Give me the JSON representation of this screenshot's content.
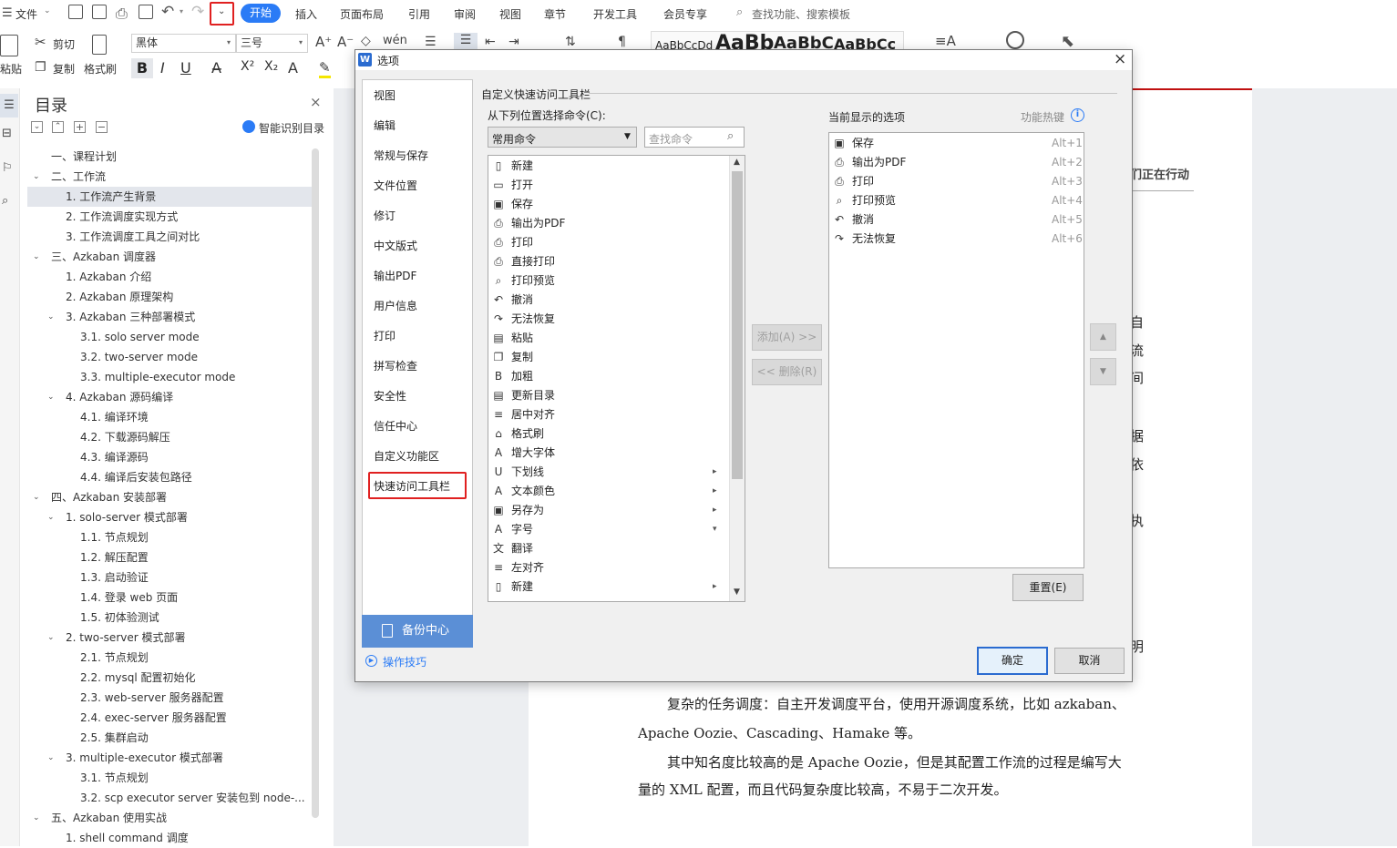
{
  "menubar": {
    "file_label": "文件",
    "tabs": [
      "开始",
      "插入",
      "页面布局",
      "引用",
      "审阅",
      "视图",
      "章节",
      "开发工具",
      "会员专享"
    ],
    "active_tab": "开始",
    "search_placeholder": "查找功能、搜索模板"
  },
  "ribbon": {
    "paste": "粘贴",
    "cut": "剪切",
    "copy": "复制",
    "format_painter": "格式刷",
    "font_name": "黑体",
    "font_size": "三号",
    "style_samples": [
      "AaBbCcDd",
      "AaBb",
      "AaBbC",
      "AaBbCc"
    ]
  },
  "toc": {
    "title": "目录",
    "smart_label": "智能识别目录",
    "items": [
      {
        "text": "一、课程计划",
        "level": 0,
        "caret": ""
      },
      {
        "text": "二、工作流",
        "level": 0,
        "caret": "v"
      },
      {
        "text": "1. 工作流产生背景",
        "level": 1,
        "caret": "",
        "selected": true
      },
      {
        "text": "2. 工作流调度实现方式",
        "level": 1,
        "caret": ""
      },
      {
        "text": "3. 工作流调度工具之间对比",
        "level": 1,
        "caret": ""
      },
      {
        "text": "三、Azkaban 调度器",
        "level": 0,
        "caret": "v"
      },
      {
        "text": "1. Azkaban 介绍",
        "level": 1,
        "caret": ""
      },
      {
        "text": "2. Azkaban 原理架构",
        "level": 1,
        "caret": ""
      },
      {
        "text": "3. Azkaban 三种部署模式",
        "level": 1,
        "caret": "v"
      },
      {
        "text": "3.1. solo server mode",
        "level": 2,
        "caret": ""
      },
      {
        "text": "3.2. two-server mode",
        "level": 2,
        "caret": ""
      },
      {
        "text": "3.3. multiple-executor mode",
        "level": 2,
        "caret": ""
      },
      {
        "text": "4. Azkaban 源码编译",
        "level": 1,
        "caret": "v"
      },
      {
        "text": "4.1. 编译环境",
        "level": 2,
        "caret": ""
      },
      {
        "text": "4.2. 下载源码解压",
        "level": 2,
        "caret": ""
      },
      {
        "text": "4.3. 编译源码",
        "level": 2,
        "caret": ""
      },
      {
        "text": "4.4. 编译后安装包路径",
        "level": 2,
        "caret": ""
      },
      {
        "text": "四、Azkaban 安装部署",
        "level": 0,
        "caret": "v"
      },
      {
        "text": "1. solo-server 模式部署",
        "level": 1,
        "caret": "v"
      },
      {
        "text": "1.1. 节点规划",
        "level": 2,
        "caret": ""
      },
      {
        "text": "1.2. 解压配置",
        "level": 2,
        "caret": ""
      },
      {
        "text": "1.3. 启动验证",
        "level": 2,
        "caret": ""
      },
      {
        "text": "1.4. 登录 web 页面",
        "level": 2,
        "caret": ""
      },
      {
        "text": "1.5. 初体验测试",
        "level": 2,
        "caret": ""
      },
      {
        "text": "2. two-server 模式部署",
        "level": 1,
        "caret": "v"
      },
      {
        "text": "2.1. 节点规划",
        "level": 2,
        "caret": ""
      },
      {
        "text": "2.2. mysql 配置初始化",
        "level": 2,
        "caret": ""
      },
      {
        "text": "2.3. web-server 服务器配置",
        "level": 2,
        "caret": ""
      },
      {
        "text": "2.4. exec-server 服务器配置",
        "level": 2,
        "caret": ""
      },
      {
        "text": "2.5. 集群启动",
        "level": 2,
        "caret": ""
      },
      {
        "text": "3. multiple-executor 模式部署",
        "level": 1,
        "caret": "v"
      },
      {
        "text": "3.1. 节点规划",
        "level": 2,
        "caret": ""
      },
      {
        "text": "3.2. scp executor server 安装包到 node-...",
        "level": 2,
        "caret": ""
      },
      {
        "text": "五、Azkaban 使用实战",
        "level": 0,
        "caret": "v"
      },
      {
        "text": "1. shell command 调度",
        "level": 1,
        "caret": ""
      }
    ]
  },
  "document": {
    "header_fragment": "们正在行动",
    "edge_chars": [
      "自",
      "流",
      "间",
      "据",
      "依",
      "执",
      "明"
    ],
    "lines": [
      "复杂的任务调度：自主开发调度平台，使用开源调度系统，比如 azkaban、",
      "Apache Oozie、Cascading、Hamake 等。",
      "其中知名度比较高的是 Apache Oozie，但是其配置工作流的过程是编写大",
      "量的 XML 配置，而且代码复杂度比较高，不易于二次开发。"
    ]
  },
  "dialog": {
    "title": "选项",
    "nav_items": [
      "视图",
      "编辑",
      "常规与保存",
      "文件位置",
      "修订",
      "中文版式",
      "输出PDF",
      "用户信息",
      "打印",
      "拼写检查",
      "安全性",
      "信任中心",
      "自定义功能区",
      "快速访问工具栏"
    ],
    "selected_nav": "快速访问工具栏",
    "backup_label": "备份中心",
    "tips_label": "操作技巧",
    "group_title": "自定义快速访问工具栏",
    "choose_label": "从下列位置选择命令(C):",
    "source_select": "常用命令",
    "search_placeholder": "查找命令",
    "current_label": "当前显示的选项",
    "hotkey_label": "功能热键",
    "commands": [
      {
        "label": "新建",
        "icon": "new-doc-icon",
        "glyph": "▯",
        "sub": ""
      },
      {
        "label": "打开",
        "icon": "open-folder-icon",
        "glyph": "▭",
        "sub": ""
      },
      {
        "label": "保存",
        "icon": "save-icon",
        "glyph": "▣",
        "sub": ""
      },
      {
        "label": "输出为PDF",
        "icon": "pdf-icon",
        "glyph": "⎙",
        "sub": ""
      },
      {
        "label": "打印",
        "icon": "print-icon",
        "glyph": "⎙",
        "sub": ""
      },
      {
        "label": "直接打印",
        "icon": "direct-print-icon",
        "glyph": "⎙",
        "sub": ""
      },
      {
        "label": "打印预览",
        "icon": "print-preview-icon",
        "glyph": "⌕",
        "sub": ""
      },
      {
        "label": "撤消",
        "icon": "undo-icon",
        "glyph": "↶",
        "sub": ""
      },
      {
        "label": "无法恢复",
        "icon": "redo-icon",
        "glyph": "↷",
        "sub": ""
      },
      {
        "label": "粘贴",
        "icon": "paste-icon",
        "glyph": "▤",
        "sub": ""
      },
      {
        "label": "复制",
        "icon": "copy-icon",
        "glyph": "❐",
        "sub": ""
      },
      {
        "label": "加粗",
        "icon": "bold-icon",
        "glyph": "B",
        "sub": ""
      },
      {
        "label": "更新目录",
        "icon": "update-toc-icon",
        "glyph": "▤",
        "sub": ""
      },
      {
        "label": "居中对齐",
        "icon": "align-center-icon",
        "glyph": "≡",
        "sub": ""
      },
      {
        "label": "格式刷",
        "icon": "format-painter-icon",
        "glyph": "⌂",
        "sub": ""
      },
      {
        "label": "增大字体",
        "icon": "grow-font-icon",
        "glyph": "A",
        "sub": ""
      },
      {
        "label": "下划线",
        "icon": "underline-icon",
        "glyph": "U",
        "sub": "▸"
      },
      {
        "label": "文本颜色",
        "icon": "font-color-icon",
        "glyph": "A",
        "sub": "▸"
      },
      {
        "label": "另存为",
        "icon": "save-as-icon",
        "glyph": "▣",
        "sub": "▸"
      },
      {
        "label": "字号",
        "icon": "font-size-icon",
        "glyph": "A",
        "sub": "▾"
      },
      {
        "label": "翻译",
        "icon": "translate-icon",
        "glyph": "文",
        "sub": ""
      },
      {
        "label": "左对齐",
        "icon": "align-left-icon",
        "glyph": "≡",
        "sub": ""
      },
      {
        "label": "新建",
        "icon": "new-doc-icon",
        "glyph": "▯",
        "sub": "▸"
      }
    ],
    "current": [
      {
        "label": "保存",
        "icon": "save-icon",
        "glyph": "▣",
        "hotkey": "Alt+1"
      },
      {
        "label": "输出为PDF",
        "icon": "pdf-icon",
        "glyph": "⎙",
        "hotkey": "Alt+2"
      },
      {
        "label": "打印",
        "icon": "print-icon",
        "glyph": "⎙",
        "hotkey": "Alt+3"
      },
      {
        "label": "打印预览",
        "icon": "print-preview-icon",
        "glyph": "⌕",
        "hotkey": "Alt+4"
      },
      {
        "label": "撤消",
        "icon": "undo-icon",
        "glyph": "↶",
        "hotkey": "Alt+5"
      },
      {
        "label": "无法恢复",
        "icon": "redo-icon",
        "glyph": "↷",
        "hotkey": "Alt+6"
      }
    ],
    "add_btn": "添加(A) >>",
    "remove_btn": "<< 删除(R)",
    "reset_btn": "重置(E)",
    "ok_btn": "确定",
    "cancel_btn": "取消"
  }
}
